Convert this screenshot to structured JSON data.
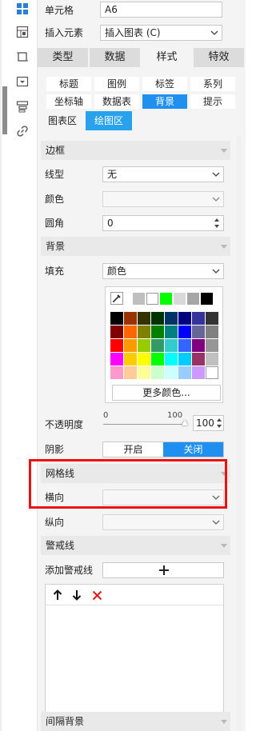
{
  "top_rows": {
    "cell_label": "单元格",
    "cell_value": "A6",
    "insert_label": "插入元素",
    "insert_value": "插入图表 (C)"
  },
  "main_tabs": [
    {
      "label": "类型",
      "active": false
    },
    {
      "label": "数据",
      "active": false
    },
    {
      "label": "样式",
      "active": true
    },
    {
      "label": "特效",
      "active": false
    }
  ],
  "sub_tabs": [
    {
      "label": "标题",
      "active": false
    },
    {
      "label": "图例",
      "active": false
    },
    {
      "label": "标签",
      "active": false
    },
    {
      "label": "系列",
      "active": false
    },
    {
      "label": "坐标轴",
      "active": false
    },
    {
      "label": "数据表",
      "active": false
    },
    {
      "label": "背景",
      "active": true
    },
    {
      "label": "提示",
      "active": false
    }
  ],
  "area_tabs": [
    {
      "label": "图表区",
      "active": false
    },
    {
      "label": "绘图区",
      "active": true
    }
  ],
  "border_section": {
    "title": "边框",
    "line_type_label": "线型",
    "line_type_value": "无",
    "color_label": "颜色",
    "radius_label": "圆角",
    "radius_value": "0"
  },
  "background_section": {
    "title": "背景",
    "fill_label": "填充",
    "fill_value": "颜色",
    "more_colors": "更多颜色...",
    "opacity_label": "不透明度",
    "opacity_min": "0",
    "opacity_max": "100",
    "opacity_value": "100",
    "shadow_label": "阴影",
    "shadow_on": "开启",
    "shadow_off": "关闭",
    "shadow_state": "关闭"
  },
  "gridline_section": {
    "title": "网格线",
    "horizontal_label": "横向",
    "vertical_label": "纵向"
  },
  "warning_section": {
    "title": "警戒线",
    "add_label": "添加警戒线",
    "add_icon": "plus-icon",
    "toolbar_icons": [
      "arrow-up-icon",
      "arrow-down-icon",
      "delete-x-icon"
    ]
  },
  "stripe_section": {
    "title": "间隔背景"
  },
  "colors": {
    "accent": "#1f90ef",
    "highlight_box": "#ee1111",
    "delete_icon": "#e02020"
  },
  "palette": {
    "recent": [
      "#bfbfbf",
      "#ffffff",
      "#00ff00",
      "#d9d9d9",
      "#a6a6a6",
      "#000000"
    ],
    "grid": [
      [
        "#000000",
        "#993300",
        "#333300",
        "#003300",
        "#003366",
        "#000080",
        "#333399",
        "#333333"
      ],
      [
        "#800000",
        "#ff6600",
        "#808000",
        "#008000",
        "#008080",
        "#0000ff",
        "#666699",
        "#808080"
      ],
      [
        "#ff0000",
        "#ff9900",
        "#99cc00",
        "#339966",
        "#33cccc",
        "#3366ff",
        "#800080",
        "#969696"
      ],
      [
        "#ff00ff",
        "#ffcc00",
        "#ffff00",
        "#00ff00",
        "#00ffff",
        "#00ccff",
        "#993366",
        "#c0c0c0"
      ],
      [
        "#ff99cc",
        "#ffcc99",
        "#ffff99",
        "#ccffcc",
        "#ccffff",
        "#99ccff",
        "#cc99ff",
        "#ffffff"
      ]
    ]
  },
  "icons": {
    "toolbar": [
      "layout-grid-icon",
      "cell-element-icon",
      "crop-frame-icon",
      "widget-icon",
      "condition-icon",
      "link-icon"
    ]
  }
}
